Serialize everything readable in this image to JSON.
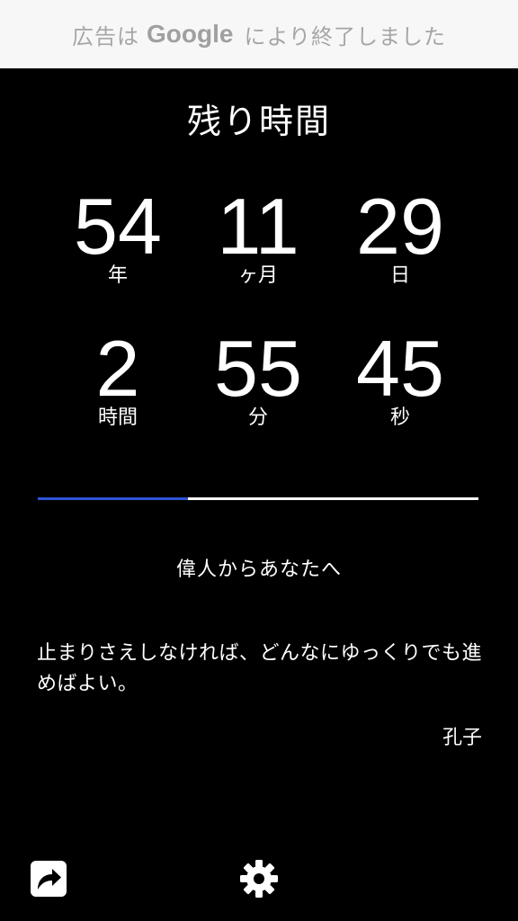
{
  "ad_banner": {
    "text_before": "広告は",
    "brand": "Google",
    "text_after": "により終了しました"
  },
  "title": "残り時間",
  "countdown": {
    "years": {
      "value": "54",
      "unit": "年"
    },
    "months": {
      "value": "11",
      "unit": "ヶ月"
    },
    "days": {
      "value": "29",
      "unit": "日"
    },
    "hours": {
      "value": "2",
      "unit": "時間"
    },
    "minutes": {
      "value": "55",
      "unit": "分"
    },
    "seconds": {
      "value": "45",
      "unit": "秒"
    }
  },
  "progress": {
    "fraction": 0.34,
    "fill_color": "#2f54d4",
    "track_color": "#ffffff"
  },
  "quote": {
    "heading": "偉人からあなたへ",
    "text": "止まりさえしなければ、どんなにゆっくりでも進めばよい。",
    "author": "孔子"
  },
  "toolbar": {
    "share_icon": "share-icon",
    "settings_icon": "gear-icon"
  }
}
